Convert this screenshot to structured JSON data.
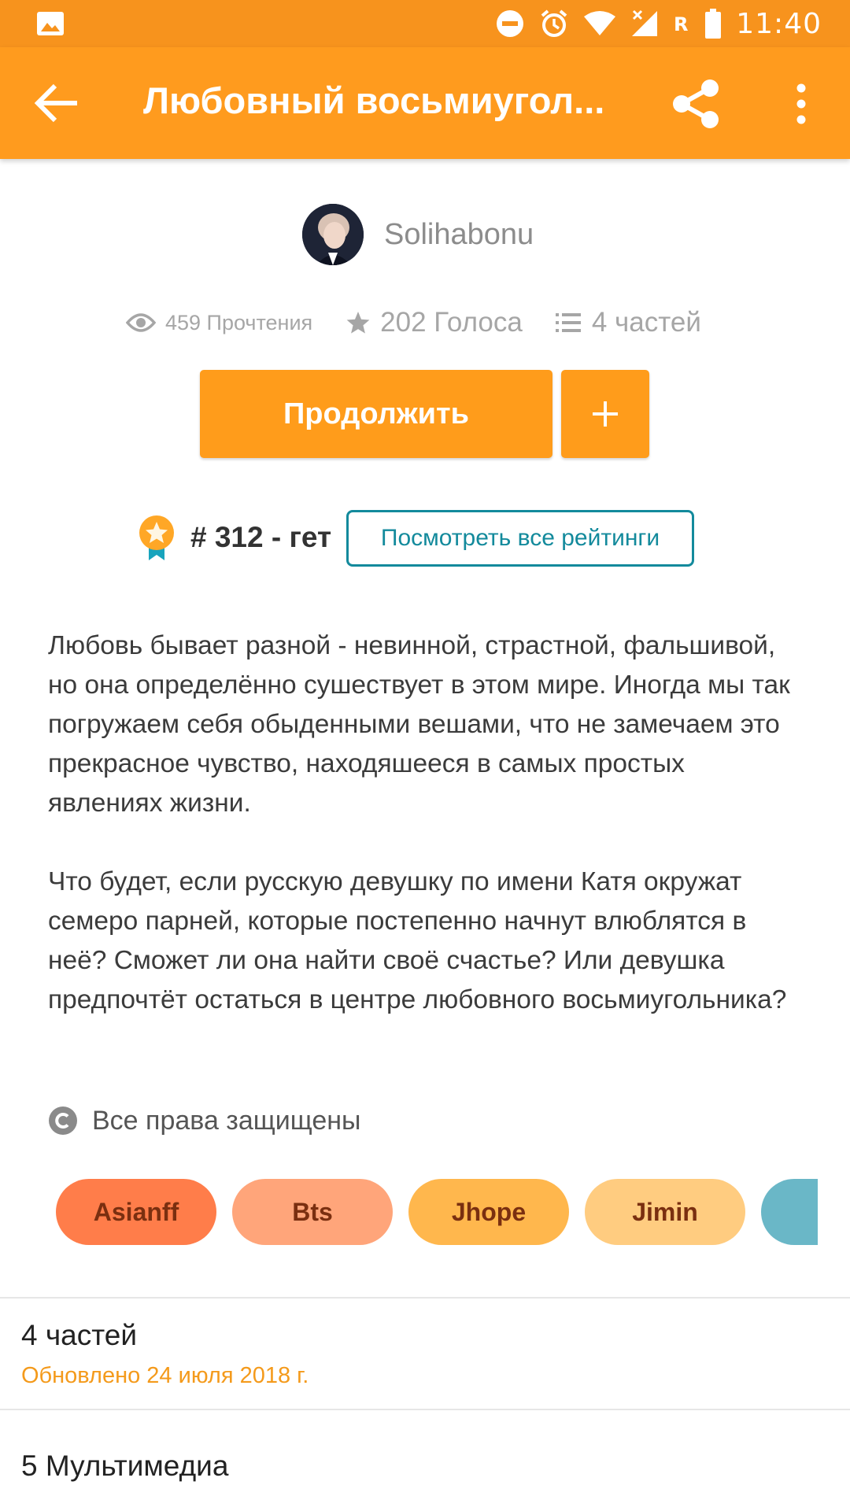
{
  "status_bar": {
    "time": "11:40",
    "icons": [
      "image-icon",
      "do-not-disturb-icon",
      "alarm-icon",
      "wifi-icon",
      "signal-icon",
      "roaming-icon",
      "battery-icon"
    ]
  },
  "app_bar": {
    "title": "Любовный восьмиугол...",
    "icons": [
      "back-arrow-icon",
      "share-icon",
      "more-vert-icon"
    ]
  },
  "author": {
    "name": "Solihabonu"
  },
  "stats": {
    "reads": "459 Прочтения",
    "votes": "202 Голоса",
    "parts": "4 частей"
  },
  "actions": {
    "continue_label": "Продолжить",
    "add_label": "+"
  },
  "ranking": {
    "text": "# 312 - гет",
    "view_all_label": "Посмотреть все рейтинги"
  },
  "description": {
    "paragraph_1": "Любовь бывает разной - невинной, страстной, фальшивой, но она определённо сушествует в этом мире. Иногда мы так погружаем себя обыденными вешами, что не замечаем это прекрасное чувство, находяшееся в самых простых явлениях жизни.",
    "paragraph_2": "Что будет, если русскую девушку по имени Катя окружат семеро парней, которые постепенно начнут влюблятся в неё? Сможет ли она найти своё счастье? Или девушка предпочтёт остаться в центре любовного восьмиугольника?"
  },
  "copyright": {
    "label": "Все права защищены"
  },
  "tags": [
    {
      "label": "Asianff",
      "color": "#ff7d4a"
    },
    {
      "label": "Bts",
      "color": "#ffa57a"
    },
    {
      "label": "Jhope",
      "color": "#ffb74d"
    },
    {
      "label": "Jimin",
      "color": "#ffcc80"
    },
    {
      "label": "",
      "color": "#6ab7c7"
    }
  ],
  "parts_section": {
    "title": "4 частей",
    "updated": "Обновлено 24 июля 2018 г."
  },
  "media_section": {
    "title": "5 Мультимедиа"
  },
  "colors": {
    "accent": "#ff9b1e",
    "status_bar": "#f7931d",
    "link": "#138a9c",
    "updated_text": "#f49a1b"
  }
}
